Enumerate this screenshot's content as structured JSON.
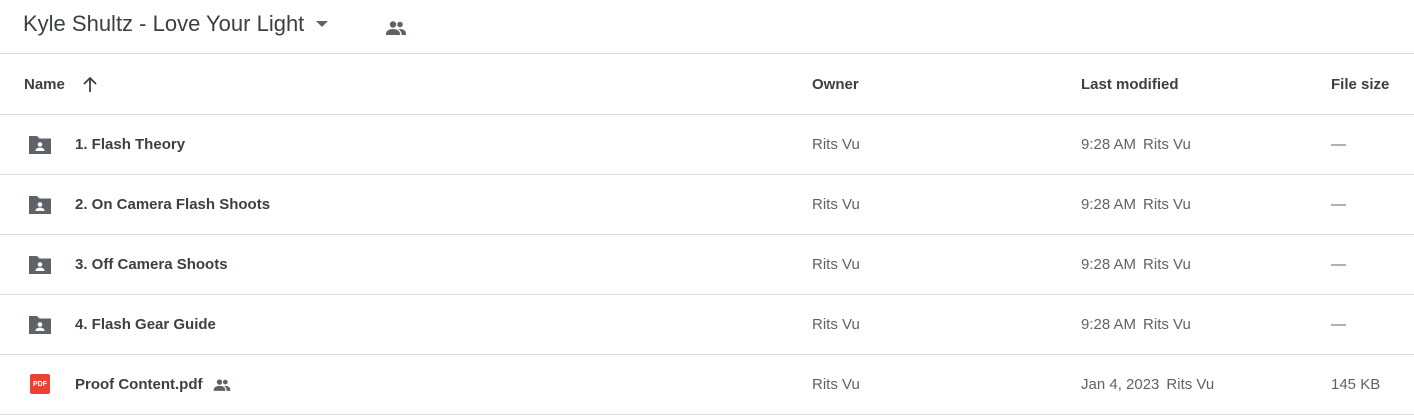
{
  "header": {
    "folder_title": "Kyle Shultz - Love Your Light",
    "caret_icon": "arrow-drop-down-icon",
    "shared_icon": "people-icon"
  },
  "columns": {
    "name": "Name",
    "owner": "Owner",
    "last_modified": "Last modified",
    "file_size": "File size",
    "sort_icon": "arrow-upward-icon"
  },
  "rows": [
    {
      "type": "shared-folder",
      "icon": "shared-folder-icon",
      "name": "1. Flash Theory",
      "owner": "Rits Vu",
      "modified_time": "9:28 AM",
      "modified_by": "Rits Vu",
      "size": "—"
    },
    {
      "type": "shared-folder",
      "icon": "shared-folder-icon",
      "name": "2. On Camera Flash Shoots",
      "owner": "Rits Vu",
      "modified_time": "9:28 AM",
      "modified_by": "Rits Vu",
      "size": "—"
    },
    {
      "type": "shared-folder",
      "icon": "shared-folder-icon",
      "name": "3. Off Camera Shoots",
      "owner": "Rits Vu",
      "modified_time": "9:28 AM",
      "modified_by": "Rits Vu",
      "size": "—"
    },
    {
      "type": "shared-folder",
      "icon": "shared-folder-icon",
      "name": "4. Flash Gear Guide",
      "owner": "Rits Vu",
      "modified_time": "9:28 AM",
      "modified_by": "Rits Vu",
      "size": "—"
    },
    {
      "type": "pdf",
      "icon": "pdf-icon",
      "badge": "PDF",
      "name": "Proof Content.pdf",
      "shared_icon": "people-icon",
      "owner": "Rits Vu",
      "modified_time": "Jan 4, 2023",
      "modified_by": "Rits Vu",
      "size": "145 KB"
    }
  ],
  "colors": {
    "text_primary": "#3c4043",
    "text_secondary": "#5f6368",
    "divider": "#dadce0",
    "icon_gray": "#5f6368",
    "pdf_red": "#ea4335"
  }
}
